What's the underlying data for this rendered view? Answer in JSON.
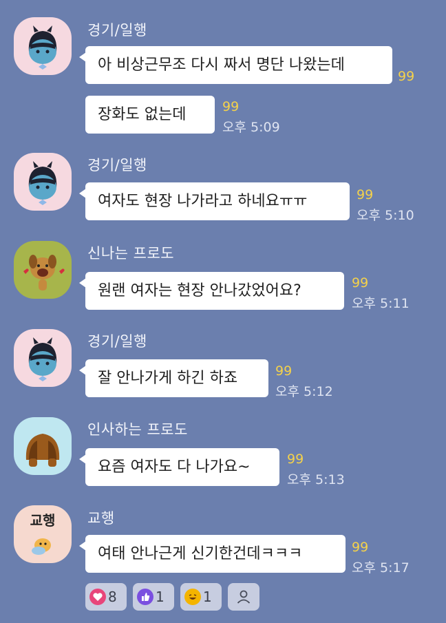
{
  "messages": [
    {
      "sender": "경기/일행",
      "lines": [
        "아 비상근무조 다시 짜서 명단 나왔는데",
        "장화도 없는데"
      ],
      "unread": [
        "99",
        "99"
      ],
      "time": "오후 5:09"
    },
    {
      "sender": "경기/일행",
      "lines": [
        "여자도 현장 나가라고 하네요ㅠㅠ"
      ],
      "unread": [
        "99"
      ],
      "time": "오후 5:10"
    },
    {
      "sender": "신나는 프로도",
      "lines": [
        "원랜 여자는 현장 안나갔었어요?"
      ],
      "unread": [
        "99"
      ],
      "time": "오후 5:11"
    },
    {
      "sender": "경기/일행",
      "lines": [
        "잘 안나가게 하긴 하죠"
      ],
      "unread": [
        "99"
      ],
      "time": "오후 5:12"
    },
    {
      "sender": "인사하는 프로도",
      "lines": [
        "요즘 여자도 다 나가요~"
      ],
      "unread": [
        "99"
      ],
      "time": "오후 5:13"
    },
    {
      "sender": "교행",
      "lines": [
        "여태 안나근게 신기한건데ㅋㅋㅋ"
      ],
      "unread": [
        "99"
      ],
      "time": "오후 5:17"
    }
  ],
  "avatar_badge": "교행",
  "reactions": [
    {
      "icon": "heart-icon",
      "count": "8",
      "color": "#e8457a"
    },
    {
      "icon": "thumbs-up-icon",
      "count": "1",
      "color": "#7a4fe0"
    },
    {
      "icon": "laughing-emoji-icon",
      "count": "1",
      "color": "#f4b400"
    },
    {
      "icon": "person-icon",
      "count": ""
    }
  ],
  "colors": {
    "background": "#6b7fae",
    "unread": "#f5d24a",
    "bubble": "#ffffff"
  }
}
